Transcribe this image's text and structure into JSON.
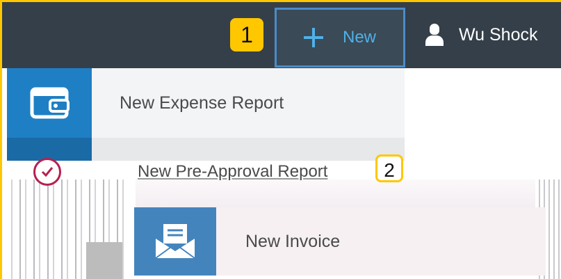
{
  "topbar": {
    "callout_1": "1",
    "new_button": {
      "label": "New",
      "icon": "plus-icon"
    },
    "user": {
      "name": "Wu Shock",
      "icon": "user-icon"
    }
  },
  "menu": {
    "items": [
      {
        "label": "New Expense Report",
        "icon": "wallet-icon"
      },
      {
        "label": "New Pre-Approval Report",
        "icon": "check-circle-icon"
      },
      {
        "label": "New Invoice",
        "icon": "envelope-icon"
      }
    ],
    "callout_2": "2"
  },
  "colors": {
    "topbar_bg": "#343f49",
    "accent_blue": "#4fb1e6",
    "callout_gold": "#ffc700",
    "expense_tile": "#1f7fc4",
    "invoice_tile": "#4484bd",
    "preapproval_ring": "#b6214f"
  }
}
